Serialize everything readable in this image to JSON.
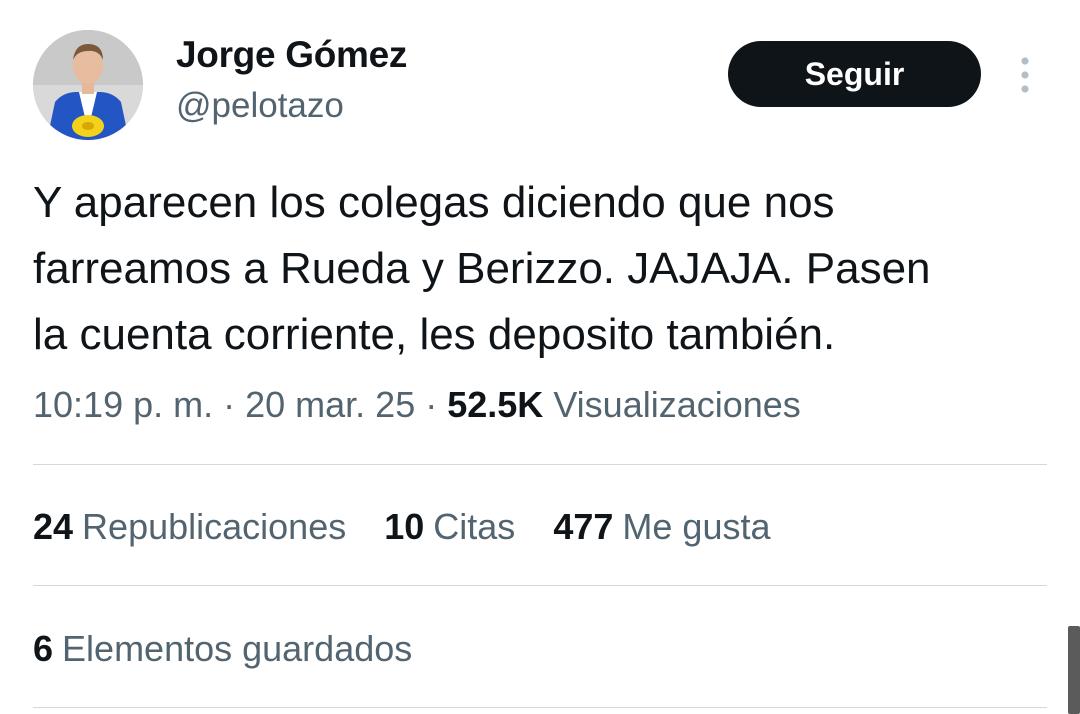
{
  "author": {
    "name": "Jorge Gómez",
    "handle": "@pelotazo",
    "avatar_icon": "profile-photo-avatar"
  },
  "follow_button": {
    "label": "Seguir"
  },
  "more_menu_icon": "more-vertical-icon",
  "tweet": {
    "lines": [
      "Y aparecen los colegas diciendo que nos",
      "farreamos a Rueda y Berizzo. JAJAJA. Pasen",
      "la cuenta corriente, les deposito también."
    ]
  },
  "meta": {
    "time": "10:19 p. m.",
    "separator": " · ",
    "date": "20 mar. 25",
    "views_count": "52.5K",
    "views_label": "Visualizaciones"
  },
  "stats": {
    "reposts": {
      "count": "24",
      "label": "Republicaciones"
    },
    "quotes": {
      "count": "10",
      "label": "Citas"
    },
    "likes": {
      "count": "477",
      "label": "Me gusta"
    },
    "bookmarks": {
      "count": "6",
      "label": "Elementos guardados"
    }
  },
  "colors": {
    "text_primary": "#0f1419",
    "text_secondary": "#536471",
    "divider": "#cfd9de",
    "button_bg": "#0f1419"
  }
}
